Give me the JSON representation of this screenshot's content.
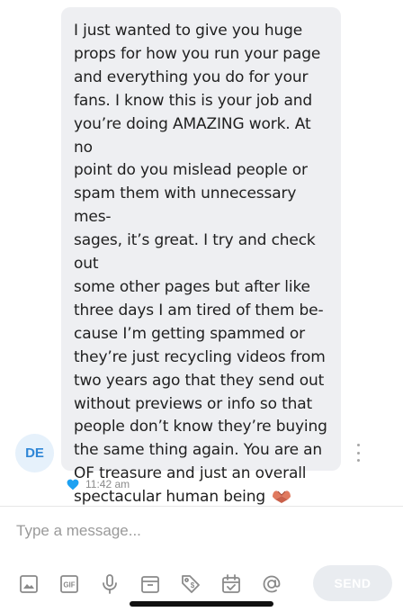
{
  "conversation": {
    "sender_initials": "DE",
    "message": {
      "text": "I just wanted to give you huge\nprops for how you run your page\nand everything you do for your\nfans. I know this is your job and\nyou’re doing AMAZING work. At no\npoint do you mislead people or\nspam them with unnecessary mes-\nsages, it’s great. I try and check out\nsome other pages but after like\nthree days I am tired of them be-\ncause I’m getting spammed or\nthey’re just recycling videos from\ntwo years ago that they send out\nwithout previews or info so that\npeople don’t know they’re buying\nthe same thing again. You are an\nOF treasure and just an overall\nspectacular human being",
      "emoji": "heart-hands-emoji",
      "timestamp": "11:42 am",
      "liked_icon": "heart-icon"
    }
  },
  "composer": {
    "placeholder": "Type a message...",
    "send_label": "SEND",
    "tools": [
      "image-icon",
      "gif-icon",
      "microphone-icon",
      "vault-icon",
      "price-tag-icon",
      "calendar-icon",
      "mention-icon"
    ]
  },
  "colors": {
    "bubble": "#eeeff2",
    "accent": "#2f86d6",
    "heart": "#1da1f2",
    "send_disabled": "#e9ecf0"
  }
}
